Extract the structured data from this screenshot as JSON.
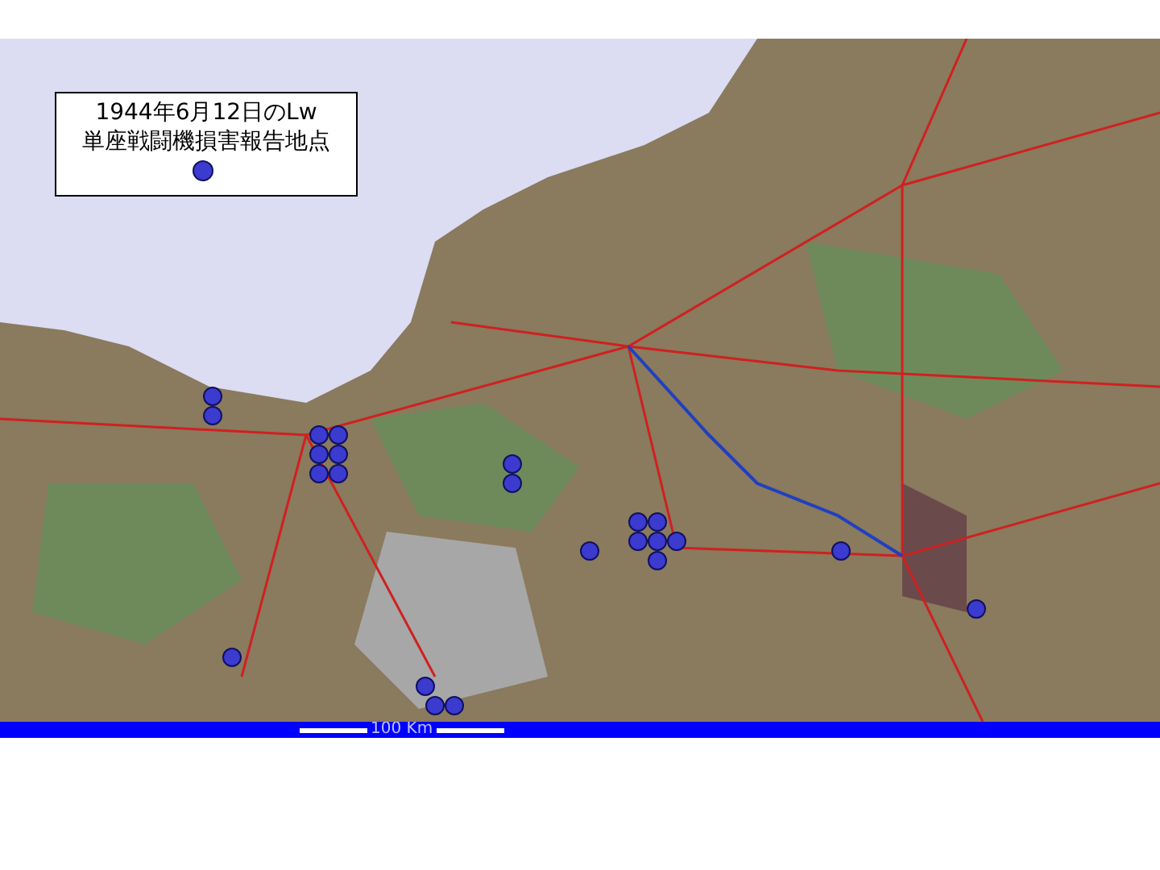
{
  "legend": {
    "title_lines": [
      "1944年6月12日のLw",
      "単座戦闘機損害報告地点"
    ]
  },
  "scale_bar": {
    "label": "100 Km"
  }
}
